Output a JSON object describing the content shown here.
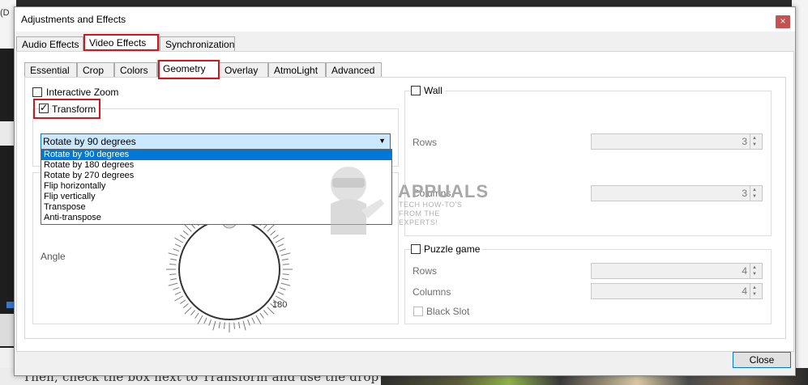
{
  "window": {
    "title": "Adjustments and Effects",
    "close_glyph": "×"
  },
  "top_tabs": [
    "Audio Effects",
    "Video Effects",
    "Synchronization"
  ],
  "sub_tabs": [
    "Essential",
    "Crop",
    "Colors",
    "Geometry",
    "Overlay",
    "AtmoLight",
    "Advanced"
  ],
  "left": {
    "interactive_zoom": "Interactive Zoom",
    "transform": "Transform",
    "transform_checked": true,
    "rotate_selected": "Rotate by 90 degrees",
    "rotate_options": [
      "Rotate by 90 degrees",
      "Rotate by 180 degrees",
      "Rotate by 270 degrees",
      "Flip horizontally",
      "Flip vertically",
      "Transpose",
      "Anti-transpose"
    ],
    "angle_label": "Angle",
    "dial_label": "180"
  },
  "right": {
    "wall": "Wall",
    "rows_label": "Rows",
    "rows_value": "3",
    "columns_label": "Columns",
    "columns_value": "3",
    "puzzle": "Puzzle game",
    "puzzle_rows_label": "Rows",
    "puzzle_rows_value": "4",
    "puzzle_columns_label": "Columns",
    "puzzle_columns_value": "4",
    "black_slot": "Black Slot"
  },
  "watermark": {
    "logo": "APPUALS",
    "tagline": "TECH HOW-TO'S FROM THE EXPERTS!"
  },
  "buttons": {
    "close": "Close"
  },
  "background": {
    "top_left_fragment": "(D",
    "bottom_text": "Then, check the box next to Transform and use the drop"
  },
  "colors": {
    "highlight": "#d6141a",
    "selection": "#0078d7",
    "combo_bg": "#cce8ff"
  }
}
